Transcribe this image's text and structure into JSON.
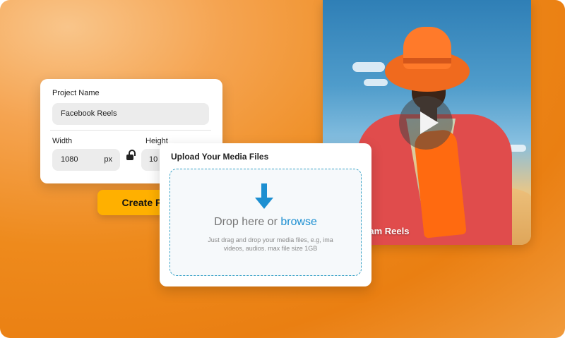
{
  "video": {
    "label": "Instagram Reels"
  },
  "project": {
    "name_label": "Project Name",
    "name_value": "Facebook Reels",
    "width_label": "Width",
    "width_value": "1080",
    "width_unit": "px",
    "height_label": "Height",
    "height_value": "10"
  },
  "create_button": {
    "label": "Create Project",
    "icon": "arrow-right-icon"
  },
  "upload": {
    "title": "Upload Your Media Files",
    "drop_text": "Drop here or ",
    "browse_link": "browse",
    "hint_line1": "Just drag and drop your media files, e.g, ima",
    "hint_line2": "videos, audios. max file size 1GB"
  },
  "colors": {
    "accent_orange": "#ee8a1c",
    "button_yellow": "#ffb000",
    "link_blue": "#1d8fd1",
    "dropzone_border": "#3aa3c7"
  }
}
